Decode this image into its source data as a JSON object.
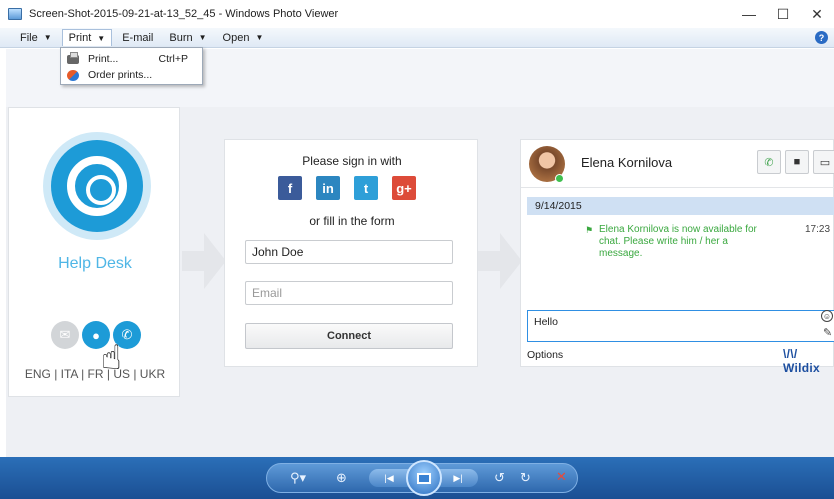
{
  "window": {
    "title": "Screen-Shot-2015-09-21-at-13_52_45 - Windows Photo Viewer",
    "minimize_glyph": "—",
    "maximize_glyph": "☐",
    "close_glyph": "✕"
  },
  "menu": {
    "items": [
      {
        "label": "File",
        "has_caret": true
      },
      {
        "label": "Print",
        "has_caret": true,
        "active": true
      },
      {
        "label": "E-mail",
        "has_caret": false
      },
      {
        "label": "Burn",
        "has_caret": true
      },
      {
        "label": "Open",
        "has_caret": true
      }
    ],
    "help_glyph": "?"
  },
  "print_menu": {
    "items": [
      {
        "label": "Print...",
        "shortcut": "Ctrl+P",
        "icon": "printer-icon"
      },
      {
        "label": "Order prints...",
        "shortcut": "",
        "icon": "order-prints-icon"
      }
    ]
  },
  "help_desk": {
    "title": "Help Desk",
    "languages": "ENG | ITA | FR | US | UKR",
    "icons": [
      "mail-icon",
      "chat-icon",
      "phone-icon"
    ]
  },
  "signin_form": {
    "heading": "Please sign in with",
    "social": [
      {
        "name": "facebook-icon",
        "glyph": "f"
      },
      {
        "name": "linkedin-icon",
        "glyph": "in"
      },
      {
        "name": "twitter-icon",
        "glyph": "t"
      },
      {
        "name": "google-plus-icon",
        "glyph": "g+"
      }
    ],
    "subheading": "or fill in the form",
    "name_value": "John Doe",
    "email_placeholder": "Email",
    "connect_label": "Connect"
  },
  "chat": {
    "contact_name": "Elena Kornilova",
    "date": "9/14/2015",
    "system_message": "Elena Kornilova is now available for chat. Please write him / her a message.",
    "message_time": "17:23",
    "input_text": "Hello",
    "options_label": "Options",
    "brand": "Wildix"
  },
  "colors": {
    "accent": "#1d9bd7",
    "status_green": "#3aa83f",
    "toolbar_blue": "#1b4f93"
  }
}
